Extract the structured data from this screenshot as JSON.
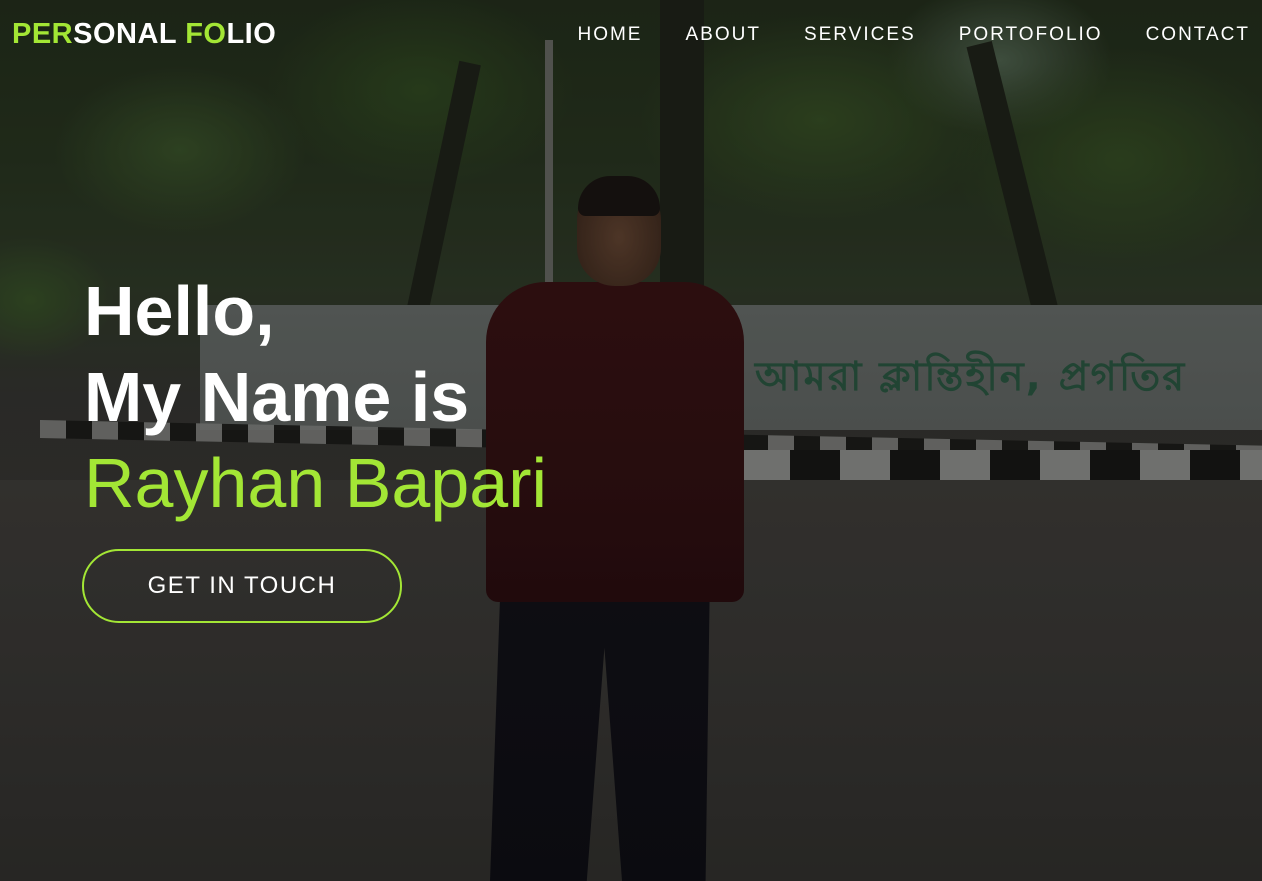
{
  "logo": {
    "part1_accent": "PER",
    "part1_plain": "SONAL ",
    "part2_accent": "FO",
    "part2_plain": "LIO"
  },
  "nav": {
    "items": [
      {
        "label": "HOME"
      },
      {
        "label": "ABOUT"
      },
      {
        "label": "SERVICES"
      },
      {
        "label": "PORTOFOLIO"
      },
      {
        "label": "CONTACT"
      }
    ]
  },
  "hero": {
    "line1": "Hello,",
    "line2": "My Name is",
    "name": "Rayhan Bapari",
    "cta_label": "GET IN TOUCH",
    "wall_text": "আমরা ক্লান্তিহীন, প্রগতির"
  },
  "colors": {
    "accent": "#a3e635",
    "text": "#ffffff"
  }
}
